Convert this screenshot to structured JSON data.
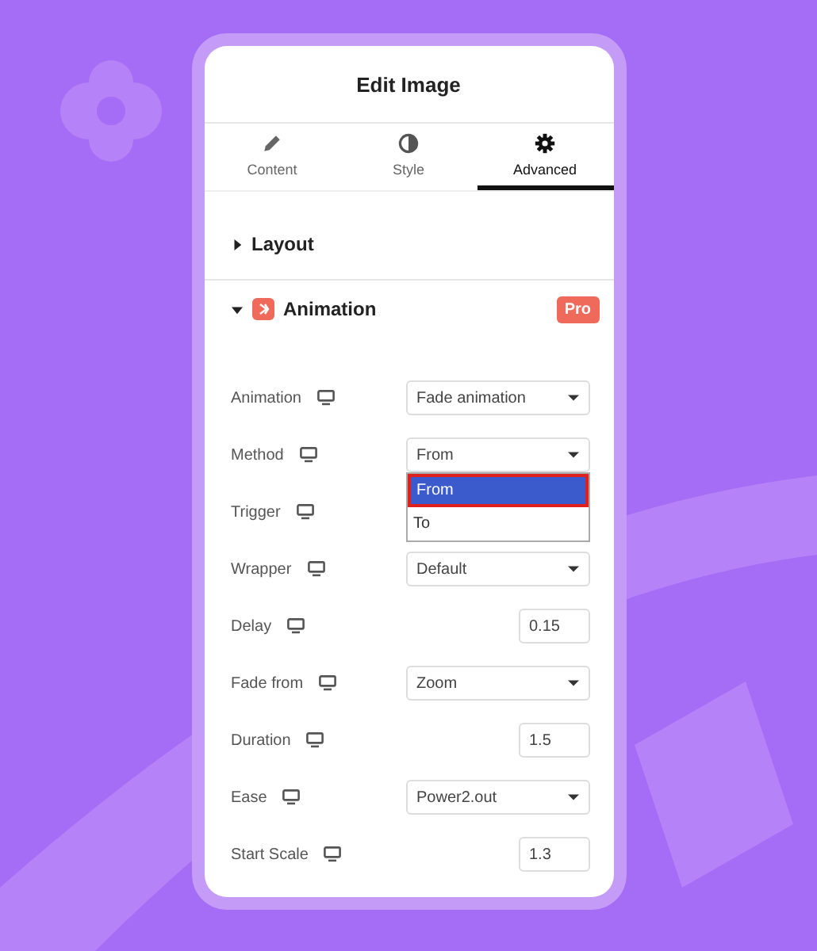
{
  "panel": {
    "title": "Edit Image"
  },
  "tabs": [
    {
      "label": "Content",
      "kind": "pencil",
      "selected": false
    },
    {
      "label": "Style",
      "kind": "contrast",
      "selected": false
    },
    {
      "label": "Advanced",
      "kind": "gear",
      "selected": true
    }
  ],
  "sections": [
    {
      "title": "Layout",
      "expanded": false
    },
    {
      "title": "Animation",
      "expanded": true,
      "badge": "Pro"
    }
  ],
  "fields": [
    {
      "label": "Animation",
      "kind": "select",
      "value": "Fade animation"
    },
    {
      "label": "Method",
      "kind": "select",
      "value": "From",
      "open": true,
      "options": [
        {
          "label": "From",
          "selected": true
        },
        {
          "label": "To",
          "selected": false
        }
      ]
    },
    {
      "label": "Trigger",
      "kind": "covered"
    },
    {
      "label": "Wrapper",
      "kind": "select",
      "value": "Default"
    },
    {
      "label": "Delay",
      "kind": "number",
      "value": "0.15"
    },
    {
      "label": "Fade from",
      "kind": "select",
      "value": "Zoom"
    },
    {
      "label": "Duration",
      "kind": "number",
      "value": "1.5"
    },
    {
      "label": "Ease",
      "kind": "select",
      "value": "Power2.out"
    },
    {
      "label": "Start Scale",
      "kind": "number",
      "value": "1.3"
    }
  ]
}
